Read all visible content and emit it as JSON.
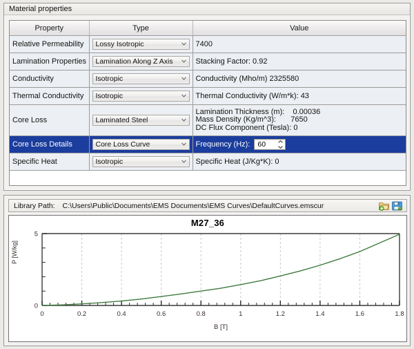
{
  "window": {
    "title": "Material properties"
  },
  "grid": {
    "columns": [
      "Property",
      "Type",
      "Value"
    ],
    "rows": [
      {
        "property": "Relative Permeability",
        "type": "Lossy Isotropic",
        "value": "7400",
        "selected": false
      },
      {
        "property": "Lamination Properties",
        "type": "Lamination Along Z Axis",
        "value": "Stacking Factor: 0.92",
        "selected": false
      },
      {
        "property": "Conductivity",
        "type": "Isotropic",
        "value": "Conductivity (Mho/m)  2325580",
        "selected": false
      },
      {
        "property": "Thermal Conductivity",
        "type": "Isotropic",
        "value": "Thermal Conductivity (W/m*k): 43",
        "selected": false
      },
      {
        "property": "Core Loss",
        "type": "Laminated Steel",
        "value_lines": [
          "Lamination Thickness (m):    0.00036",
          "Mass Density (Kg/m^3):       7650",
          "DC Flux Component (Tesla): 0"
        ],
        "selected": false
      },
      {
        "property": "Core Loss Details",
        "type": "Core Loss Curve",
        "value_label": "Frequency (Hz):",
        "value_field": "60",
        "selected": true
      },
      {
        "property": "Specific Heat",
        "type": "Isotropic",
        "value": "Specific Heat (J/Kg*K): 0",
        "selected": false
      }
    ]
  },
  "library": {
    "label": "Library Path:",
    "path": "C:\\Users\\Public\\Documents\\EMS Documents\\EMS Curves\\DefaultCurves.emscur",
    "open_icon": "open-folder-icon",
    "save_icon": "save-disk-icon"
  },
  "colors": {
    "selection_blue": "#1b3d9e",
    "curve_green": "#3f7a3f",
    "grid_gray": "#c8c8c8"
  },
  "chart_data": {
    "type": "line",
    "title": "M27_36",
    "xlabel": "B [T]",
    "ylabel": "P [W/kg]",
    "xlim": [
      0,
      1.8
    ],
    "ylim": [
      0,
      5
    ],
    "xticks": [
      "0",
      "0.2",
      "0.4",
      "0.6",
      "0.8",
      "1",
      "1.2",
      "1.4",
      "1.6",
      "1.8"
    ],
    "yticks": [
      "0",
      "5"
    ],
    "grid": true,
    "legend": "none",
    "series": [
      {
        "name": "M27_36",
        "x": [
          0,
          0.1,
          0.2,
          0.3,
          0.4,
          0.5,
          0.6,
          0.7,
          0.8,
          0.9,
          1.0,
          1.1,
          1.2,
          1.3,
          1.4,
          1.5,
          1.6,
          1.7,
          1.8
        ],
        "y": [
          0,
          0.04,
          0.11,
          0.2,
          0.31,
          0.45,
          0.62,
          0.8,
          1.0,
          1.2,
          1.45,
          1.72,
          2.05,
          2.4,
          2.8,
          3.25,
          3.75,
          4.35,
          4.95
        ]
      }
    ]
  }
}
